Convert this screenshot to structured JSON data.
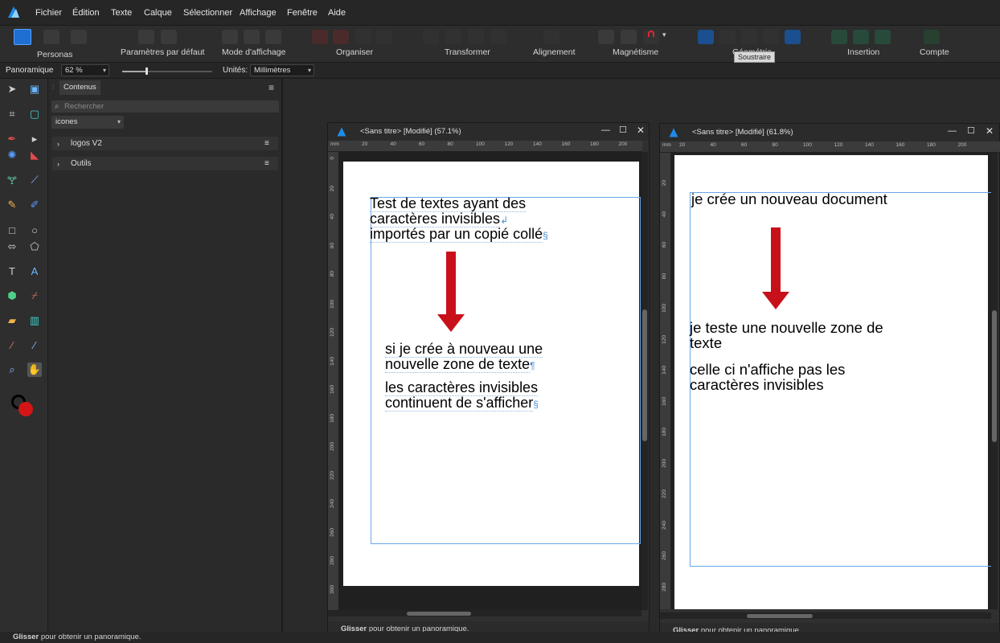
{
  "menubar": {
    "items": [
      "Fichier",
      "Édition",
      "Texte",
      "Calque",
      "Sélectionner",
      "Affichage",
      "Fenêtre",
      "Aide"
    ]
  },
  "toolbar": {
    "persona_label": "Personas",
    "groups": [
      "Paramètres par défaut",
      "Mode d'affichage",
      "Organiser",
      "Transformer",
      "Alignement",
      "Magnétisme",
      "Géométrie",
      "Insertion",
      "Compte"
    ],
    "tooltip": "Soustraire"
  },
  "contextbar": {
    "tool_name": "Panoramique",
    "zoom_value": "62 %",
    "zoom_level": 0.27,
    "units_label": "Unités:",
    "units_value": "Millimètres"
  },
  "panel": {
    "tab_label": "Contenus",
    "search_placeholder": "Rechercher",
    "category_value": "icones",
    "rows": [
      "logos V2",
      "Outils"
    ]
  },
  "doc1": {
    "title": "<Sans titre> [Modifié] (57.1%)",
    "ruler_h": [
      "mm",
      "20",
      "40",
      "60",
      "80",
      "100",
      "120",
      "140",
      "160",
      "180",
      "200"
    ],
    "ruler_v": [
      "0",
      "20",
      "40",
      "60",
      "80",
      "100",
      "120",
      "140",
      "160",
      "180",
      "200",
      "220",
      "240",
      "260",
      "280",
      "300"
    ],
    "text_top": [
      "Test de textes ayant des",
      "caractères invisibles",
      "importés par un copié collé"
    ],
    "text_mid": [
      "si je crée à nouveau une",
      "nouvelle zone de texte"
    ],
    "text_bot": [
      "les caractères invisibles",
      "continuent de s'afficher"
    ],
    "mark_break": "↲",
    "mark_pilcrow": "¶",
    "mark_section": "§",
    "status_bold": "Glisser",
    "status_rest": "pour obtenir un panoramique."
  },
  "doc2": {
    "title": "<Sans titre> [Modifié] (61.8%)",
    "ruler_h": [
      "mm",
      "20",
      "40",
      "60",
      "80",
      "100",
      "120",
      "140",
      "160",
      "180",
      "200"
    ],
    "ruler_v": [
      "20",
      "40",
      "60",
      "80",
      "100",
      "120",
      "140",
      "160",
      "180",
      "200",
      "220",
      "240",
      "260",
      "280"
    ],
    "text_top": "je crée un nouveau document",
    "text_mid": [
      "je teste une nouvelle zone de",
      "texte"
    ],
    "text_bot": [
      "celle ci n'affiche pas les",
      "caractères invisibles"
    ],
    "status_bold": "Glisser",
    "status_rest": "pour obtenir un panoramique."
  },
  "statusbar": {
    "bold": "Glisser",
    "rest": "pour obtenir un panoramique."
  },
  "colors": {
    "accent": "#1e6fd1",
    "arrow": "#c8101a",
    "frame": "#6aa6e8"
  }
}
